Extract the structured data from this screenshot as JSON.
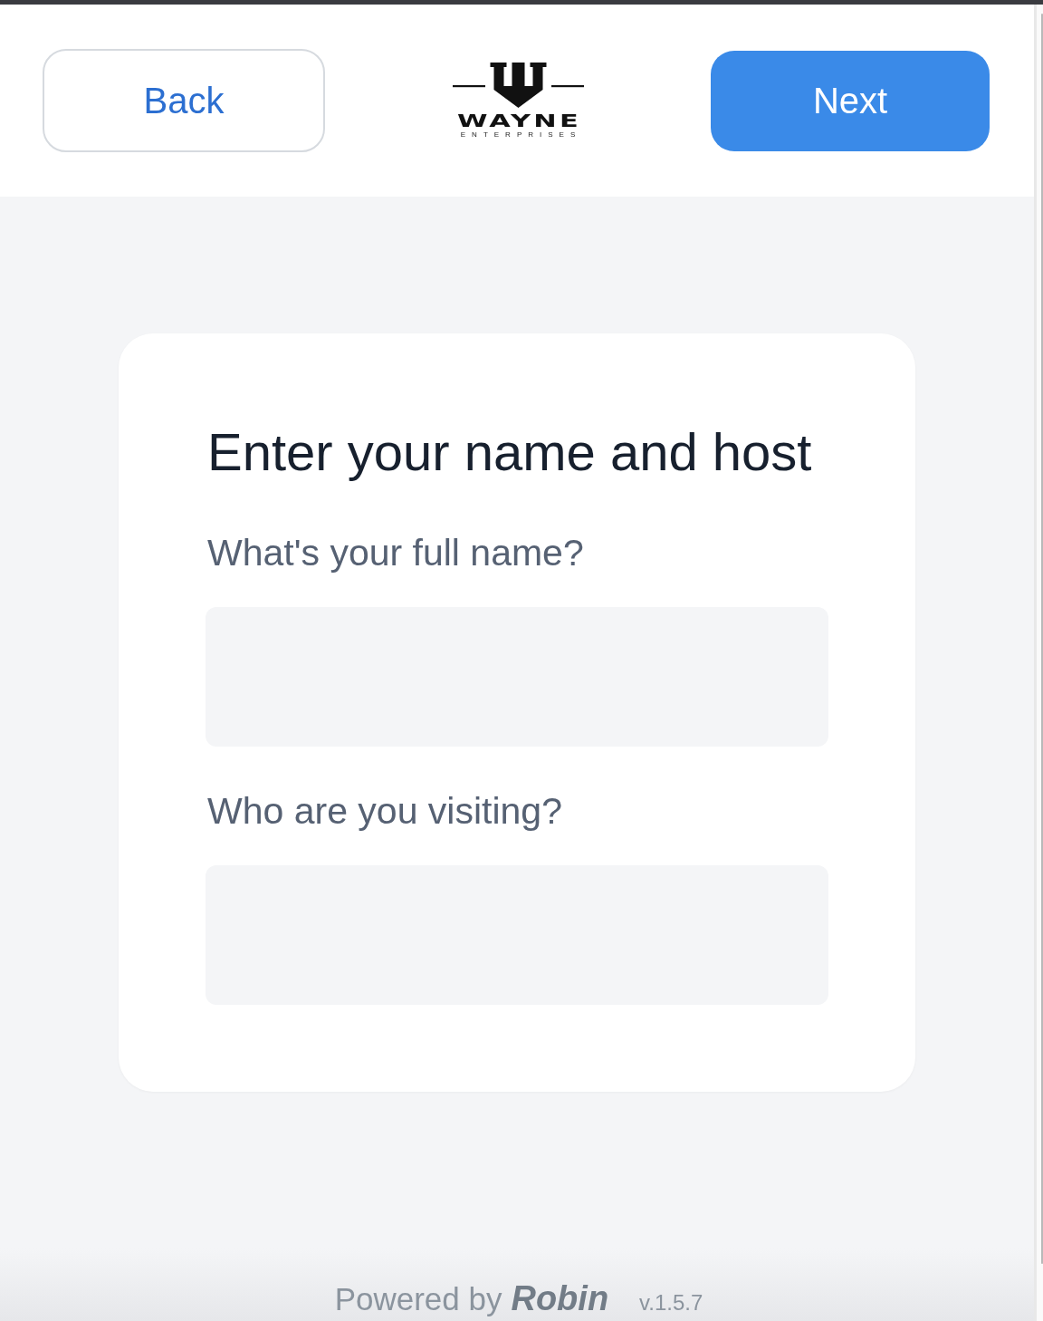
{
  "header": {
    "back_button": "Back",
    "logo": {
      "wordmark": "WAYNE",
      "tagline": "ENTERPRISES"
    },
    "next_button": "Next"
  },
  "card": {
    "title": "Enter your name and host",
    "fields": [
      {
        "label": "What's your full name?"
      },
      {
        "label": "Who are you visiting?"
      }
    ]
  },
  "footer": {
    "powered_by": "Powered by",
    "brand": "Robin",
    "version": "v.1.5.7"
  }
}
